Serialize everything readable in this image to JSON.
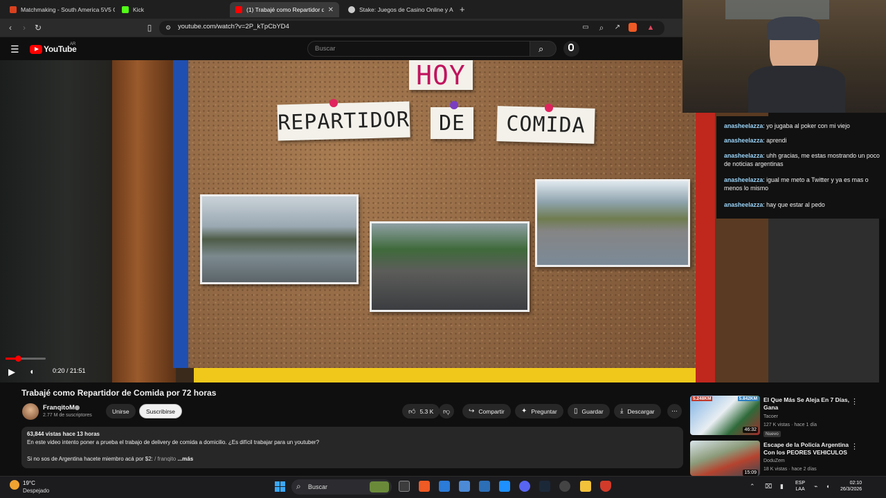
{
  "browser": {
    "tabs": [
      {
        "label": "Matchmaking - South America 5V5 C",
        "color": "#d9411e"
      },
      {
        "label": "Kick",
        "color": "#53fc18"
      },
      {
        "label": "(1) Trabajé como Repartidor de C",
        "color": "#ff0000",
        "active": true
      },
      {
        "label": "Stake: Juegos de Casino Online y Ap",
        "color": "#cccccc"
      }
    ],
    "new_tab": "+",
    "close_glyph": "✕",
    "url": "youtube.com/watch?v=2P_kTpCbYD4"
  },
  "youtube": {
    "logo_text": "YouTube",
    "country": "AR",
    "search_placeholder": "Buscar"
  },
  "video": {
    "board_words": [
      "HOY",
      "REPARTIDOR",
      "DE",
      "COMIDA"
    ],
    "time": "0:20 / 21:51",
    "progress_fraction": 0.0153
  },
  "chat": [
    {
      "user": "anasheelazza",
      "text": "yo jugaba al poker con mi viejo"
    },
    {
      "user": "anasheelazza",
      "text": "aprendi"
    },
    {
      "user": "anasheelazza",
      "text": "uhh gracias, me estas mostrando un poco de noticias argentinas"
    },
    {
      "user": "anasheelazza",
      "text": "igual me meto a Twitter y ya es mas o menos lo mismo"
    },
    {
      "user": "anasheelazza",
      "text": "hay que estar al pedo"
    }
  ],
  "details": {
    "title": "Trabajé como Repartidor de Comida por 72 horas",
    "channel": "FranqitoM",
    "subscribers": "2.77 M de suscriptores",
    "join_label": "Unirse",
    "subscribe_label": "Suscribirse",
    "likes": "5.3 K",
    "share_label": "Compartir",
    "ask_label": "Preguntar",
    "save_label": "Guardar",
    "download_label": "Descargar",
    "more_actions": "⋯",
    "desc_stats": "63,844 vistas  hace 13 horas",
    "desc_line1": "En este video intento poner a prueba el trabajo de delivery de comida a domicilio. ¿Es difícil trabajar para un youtuber?",
    "desc_line2": "Si no sos de Argentina hacete miembro acá por $2:  ",
    "desc_link": "/ franqito",
    "desc_more": "...más"
  },
  "recommendations": [
    {
      "title": "El Que Más Se Aleja En 7 Días, Gana",
      "channel": "Tacoer",
      "meta": "127 K vistas · hace 1 día",
      "badge": "Nuevo",
      "duration": "46:32",
      "thumb_labels": [
        "5.248KM",
        "5.842KM"
      ]
    },
    {
      "title": "Escape de la Policía Argentina Con los PEORES VEHICULOS",
      "channel": "DoduZem",
      "meta": "18 K vistas · hace 2 días",
      "duration": "15:09"
    }
  ],
  "taskbar": {
    "temperature": "19°C",
    "condition": "Despejado",
    "search_label": "Buscar",
    "lang_top": "ESP",
    "lang_bottom": "LAA",
    "time": "02:10",
    "date": "26/3/2026"
  }
}
